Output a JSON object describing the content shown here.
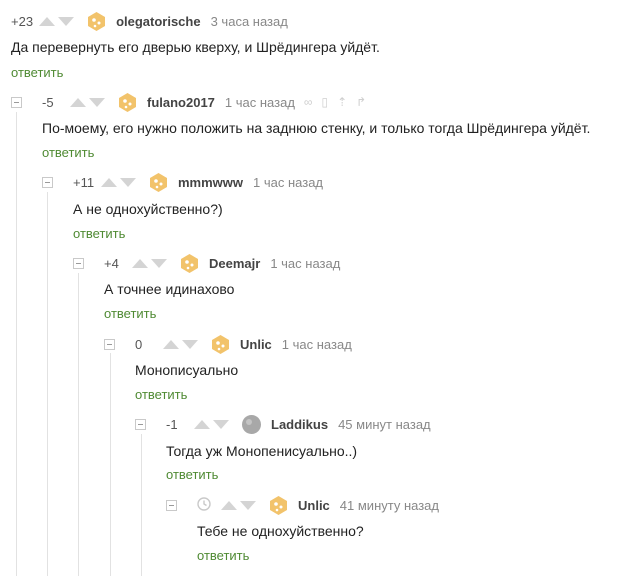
{
  "comments": [
    {
      "rating": "+23",
      "author": "olegatorische",
      "time": "3 часа назад",
      "text": "Да перевернуть его дверью кверху, и Шрёдингера уйдёт.",
      "reply": "ответить"
    },
    {
      "rating": "-5",
      "author": "fulano2017",
      "time": "1 час назад",
      "text": "По-моему, его нужно положить на заднюю стенку, и только тогда Шрёдингера уйдёт.",
      "reply": "ответить"
    },
    {
      "rating": "+11",
      "author": "mmmwww",
      "time": "1 час назад",
      "text": "А не однохуйственно?)",
      "reply": "ответить"
    },
    {
      "rating": "+4",
      "author": "Deemajr",
      "time": "1 час назад",
      "text": "А точнее идинахово",
      "reply": "ответить"
    },
    {
      "rating": "0",
      "author": "Unlic",
      "time": "1 час назад",
      "text": "Монописуально",
      "reply": "ответить"
    },
    {
      "rating": "-1",
      "author": "Laddikus",
      "time": "45 минут назад",
      "text": "Тогда уж Монопенисуально..)",
      "reply": "ответить"
    },
    {
      "rating": "",
      "author": "Unlic",
      "time": "41 минуту назад",
      "text": "Тебе не однохуйственно?",
      "reply": "ответить"
    }
  ],
  "colors": {
    "reply": "#4f8a33",
    "avatar": "#f2c36b",
    "avatar_gray": "#a8a8a8"
  }
}
